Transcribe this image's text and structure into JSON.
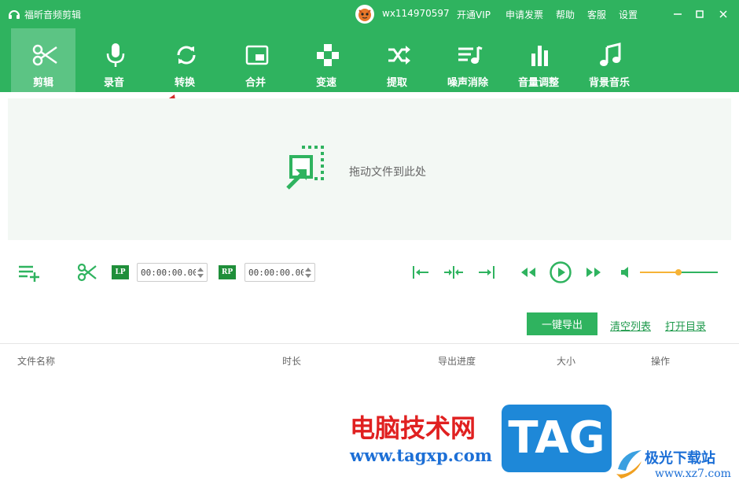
{
  "app": {
    "title": "福昕音频剪辑"
  },
  "header": {
    "user": "wx114970597",
    "links": [
      "开通VIP",
      "申请发票",
      "帮助",
      "客服",
      "设置"
    ]
  },
  "toolbar": {
    "tools": [
      {
        "label": "剪辑",
        "icon": "scissors-icon",
        "active": true
      },
      {
        "label": "录音",
        "icon": "microphone-icon",
        "active": false
      },
      {
        "label": "转换",
        "icon": "convert-icon",
        "active": false
      },
      {
        "label": "合并",
        "icon": "merge-icon",
        "active": false
      },
      {
        "label": "变速",
        "icon": "speed-icon",
        "active": false
      },
      {
        "label": "提取",
        "icon": "shuffle-icon",
        "active": false
      },
      {
        "label": "噪声消除",
        "icon": "noise-reduce-icon",
        "active": false
      },
      {
        "label": "音量调整",
        "icon": "volume-bars-icon",
        "active": false
      },
      {
        "label": "背景音乐",
        "icon": "music-note-icon",
        "active": false
      }
    ]
  },
  "dropzone": {
    "text": "拖动文件到此处"
  },
  "controls": {
    "lp_label": "LP",
    "rp_label": "RP",
    "lp_time": "00:00:00.00",
    "rp_time": "00:00:00.00",
    "volume": 0.49
  },
  "actions": {
    "export_label": "一键导出",
    "clear_label": "清空列表",
    "open_dir_label": "打开目录"
  },
  "table": {
    "columns": [
      "文件名称",
      "时长",
      "导出进度",
      "大小",
      "操作"
    ]
  },
  "watermark": {
    "cn": "电脑技术网",
    "url": "www.tagxp.com",
    "tag": "TAG",
    "site": "极光下载站",
    "site_url": "www.xz7.com"
  },
  "colors": {
    "brand": "#2fb35f",
    "accent": "#f6b336",
    "arrow": "#d42a2a"
  }
}
